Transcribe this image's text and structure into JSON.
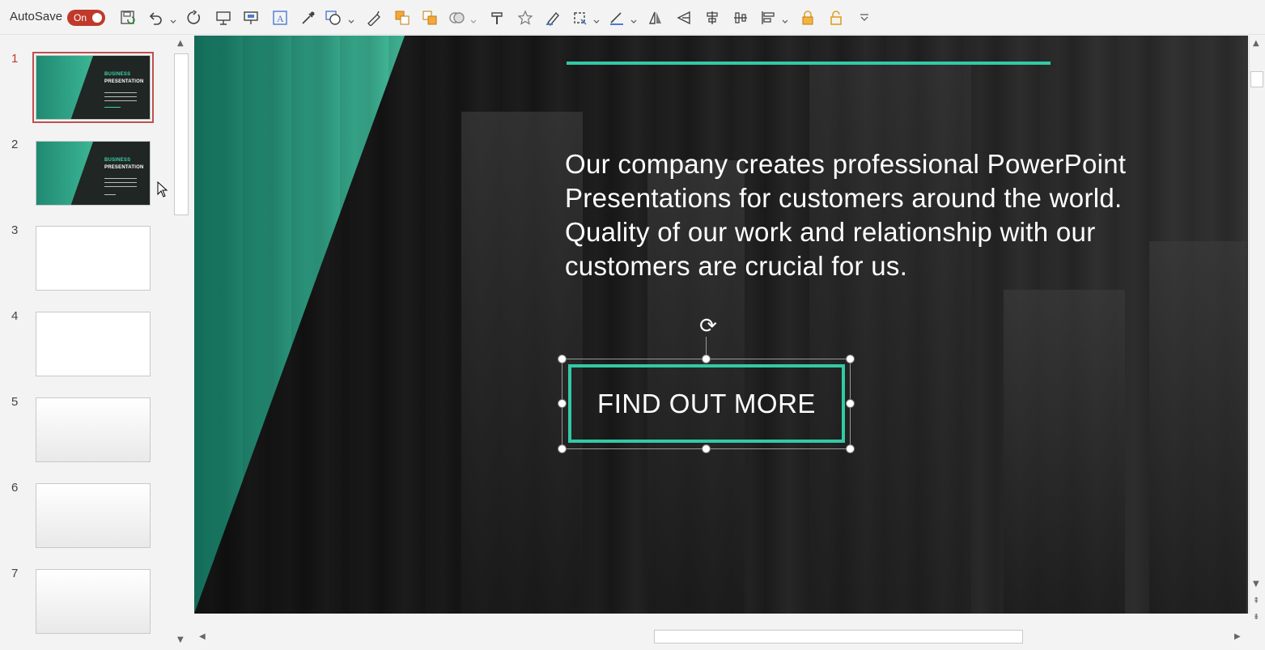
{
  "toolbar": {
    "autosave_label": "AutoSave",
    "autosave_state": "On",
    "accent_color": "#c0392b",
    "icons": [
      "save-icon",
      "undo-icon",
      "redo-icon",
      "present-from-start-icon",
      "present-from-current-icon",
      "text-box-icon",
      "eyedropper-icon",
      "shapes-icon",
      "pen-icon",
      "bring-forward-icon",
      "send-backward-icon",
      "merge-shapes-icon",
      "format-painter-icon",
      "star-icon",
      "highlighter-icon",
      "crop-icon",
      "line-style-icon",
      "flip-horizontal-icon",
      "flip-vertical-icon",
      "align-center-icon",
      "distribute-icon",
      "align-icon",
      "lock-icon",
      "unlock-icon",
      "customize-toolbar-icon"
    ]
  },
  "thumbnails": {
    "slides": [
      {
        "number": "1",
        "title_line1": "BUSINESS",
        "title_line2": "PRESENTATION",
        "style": "dark",
        "selected": true
      },
      {
        "number": "2",
        "title_line1": "BUSINESS",
        "title_line2": "PRESENTATION",
        "style": "dark",
        "selected": false
      },
      {
        "number": "3",
        "style": "blank"
      },
      {
        "number": "4",
        "style": "blank"
      },
      {
        "number": "5",
        "style": "grey"
      },
      {
        "number": "6",
        "style": "grey"
      },
      {
        "number": "7",
        "style": "grey"
      }
    ]
  },
  "slide": {
    "body_text": "Our company creates professional PowerPoint Presentations for customers around the world. Quality of our work and relationship with our customers are crucial for us.",
    "cta_label": "FIND OUT MORE",
    "accent_color": "#33c9a6"
  }
}
